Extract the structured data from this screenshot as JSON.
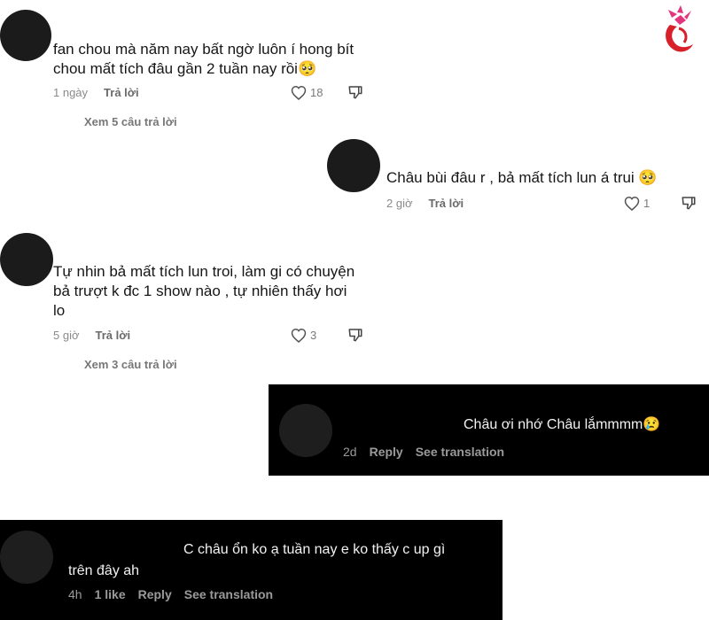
{
  "logo": {
    "name": "brand-logo"
  },
  "comments": [
    {
      "text_line1": "fan chou mà năm nay bất ngờ luôn í hong bít",
      "text_line2": "chou mất tích đâu gần 2 tuần nay rồi🥺",
      "time": "1 ngày",
      "reply": "Trả lời",
      "likes": "18",
      "view_more": "Xem 5 câu trả lời"
    },
    {
      "text_line1": "Châu bùi đâu r , bả mất tích lun á trui 🥺",
      "time": "2 giờ",
      "reply": "Trả lời",
      "likes": "1"
    },
    {
      "text_line1": "Tự nhin bả mất tích lun troi, làm gi có chuyện",
      "text_line2": "bả trượt k đc 1 show nào , tự nhiên thấy hơi",
      "text_line3": "lo",
      "time": "5 giờ",
      "reply": "Trả lời",
      "likes": "3",
      "view_more": "Xem 3 câu trả lời"
    }
  ],
  "dark_comments": [
    {
      "text_line1": "Châu ơi nhớ Châu lắmmmm😢",
      "time": "2d",
      "reply": "Reply",
      "translate": "See translation"
    },
    {
      "text_line1": "C châu ổn ko ạ tuần nay e ko thấy c up gì",
      "text_line2": "trên đây ah",
      "time": "4h",
      "likes": "1 like",
      "reply": "Reply",
      "translate": "See translation"
    }
  ],
  "colors": {
    "logo_pink": "#e3357e",
    "logo_red": "#d8202a"
  }
}
